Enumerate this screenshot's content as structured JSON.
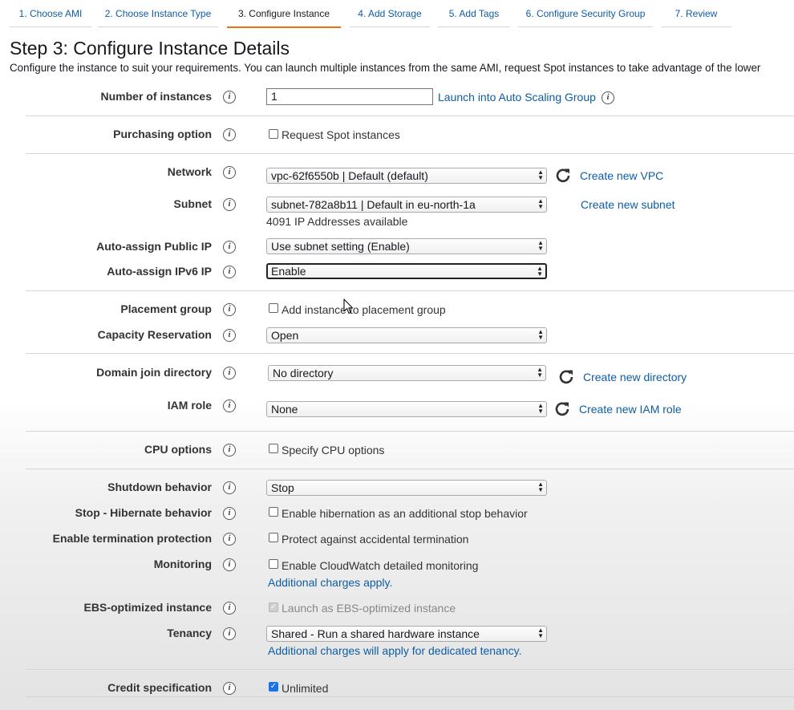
{
  "tabs": [
    {
      "label": "1. Choose AMI"
    },
    {
      "label": "2. Choose Instance Type"
    },
    {
      "label": "3. Configure Instance"
    },
    {
      "label": "4. Add Storage"
    },
    {
      "label": "5. Add Tags"
    },
    {
      "label": "6. Configure Security Group"
    },
    {
      "label": "7. Review"
    }
  ],
  "active_tab": "3. Configure Instance",
  "title": "Step 3: Configure Instance Details",
  "description": "Configure the instance to suit your requirements. You can launch multiple instances from the same AMI, request Spot instances to take advantage of the lower",
  "info_icon": "info-icon",
  "fields": {
    "number_of_instances": {
      "label": "Number of instances",
      "value": "1",
      "link": "Launch into Auto Scaling Group"
    },
    "purchasing_option": {
      "label": "Purchasing option",
      "checkbox": "Request Spot instances",
      "checked": false
    },
    "network": {
      "label": "Network",
      "value": "vpc-62f6550b | Default (default)",
      "link": "Create new VPC"
    },
    "subnet": {
      "label": "Subnet",
      "value": "subnet-782a8b11 | Default in eu-north-1a",
      "note": "4091 IP Addresses available",
      "link": "Create new subnet"
    },
    "auto_assign_public_ip": {
      "label": "Auto-assign Public IP",
      "value": "Use subnet setting (Enable)"
    },
    "auto_assign_ipv6": {
      "label": "Auto-assign IPv6 IP",
      "value": "Enable"
    },
    "placement_group": {
      "label": "Placement group",
      "checkbox": "Add instance to placement group",
      "checked": false
    },
    "capacity_reservation": {
      "label": "Capacity Reservation",
      "value": "Open"
    },
    "domain_join_directory": {
      "label": "Domain join directory",
      "value": "No directory",
      "link": "Create new directory"
    },
    "iam_role": {
      "label": "IAM role",
      "value": "None",
      "link": "Create new IAM role"
    },
    "cpu_options": {
      "label": "CPU options",
      "checkbox": "Specify CPU options",
      "checked": false
    },
    "shutdown_behavior": {
      "label": "Shutdown behavior",
      "value": "Stop"
    },
    "stop_hibernate": {
      "label": "Stop - Hibernate behavior",
      "checkbox": "Enable hibernation as an additional stop behavior",
      "checked": false
    },
    "termination_protection": {
      "label": "Enable termination protection",
      "checkbox": "Protect against accidental termination",
      "checked": false
    },
    "monitoring": {
      "label": "Monitoring",
      "checkbox": "Enable CloudWatch detailed monitoring",
      "checked": false,
      "link": "Additional charges apply."
    },
    "ebs_optimized": {
      "label": "EBS-optimized instance",
      "checkbox": "Launch as EBS-optimized instance",
      "checked": true,
      "disabled": true
    },
    "tenancy": {
      "label": "Tenancy",
      "value": "Shared - Run a shared hardware instance",
      "link": "Additional charges will apply for dedicated tenancy."
    },
    "credit_specification": {
      "label": "Credit specification",
      "checkbox": "Unlimited",
      "checked": true
    }
  },
  "colors": {
    "link": "#0e5da3",
    "active_tab_underline": "#ec7211",
    "checkbox_checked": "#1a73e8"
  }
}
